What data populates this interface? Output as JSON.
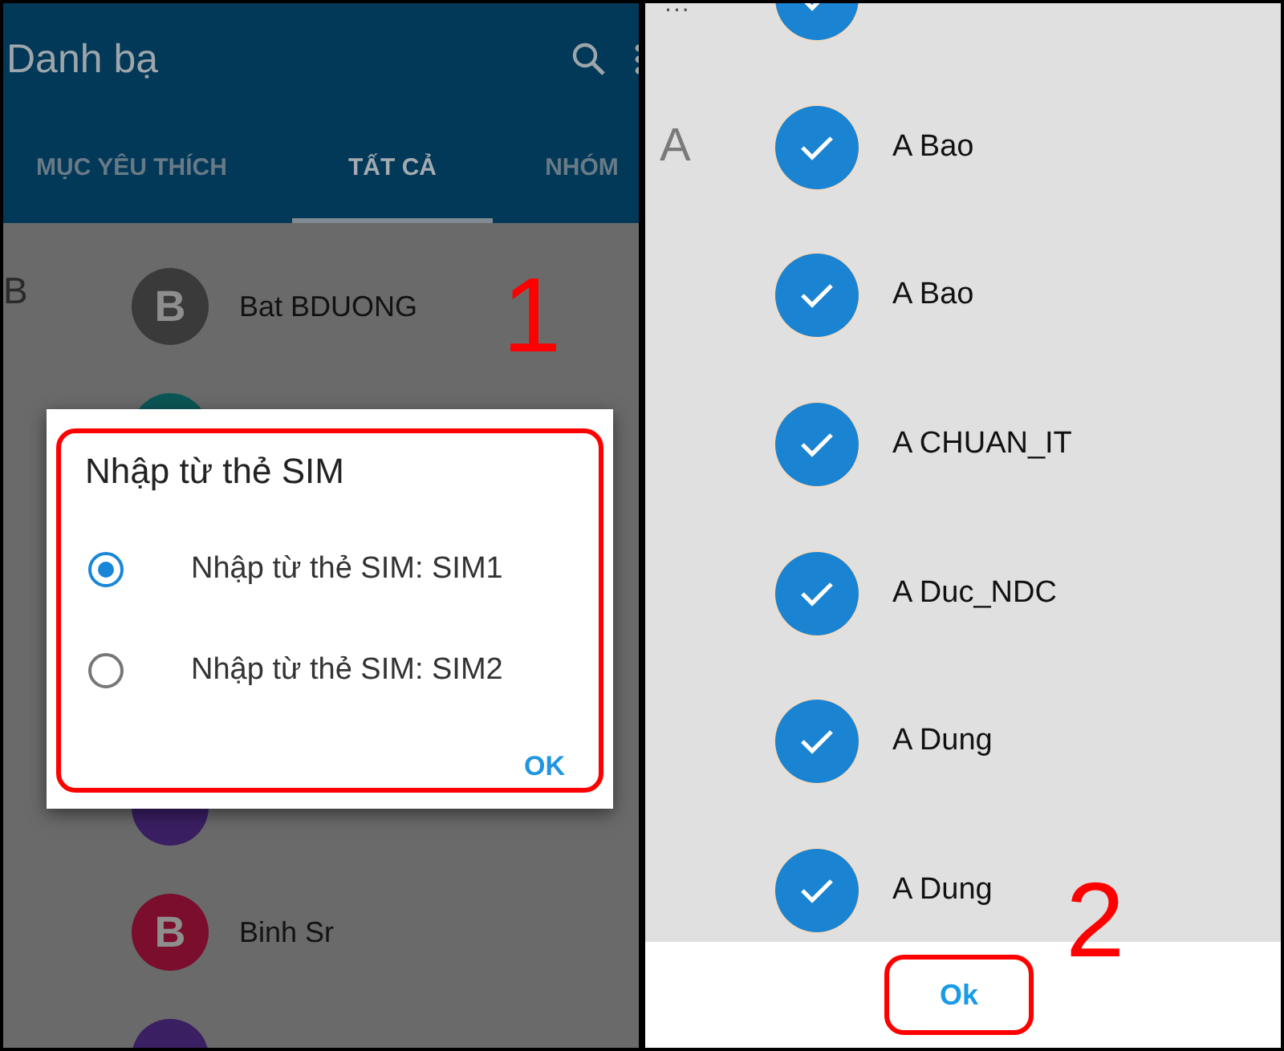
{
  "left_screen": {
    "app_bar": {
      "title": "Danh bạ"
    },
    "tabs": [
      {
        "label": "MỤC YÊU THÍCH",
        "selected": false
      },
      {
        "label": "TẤT CẢ",
        "selected": true
      },
      {
        "label": "NHÓM",
        "selected": false
      }
    ],
    "contacts": [
      {
        "section": "B",
        "initial": "B",
        "name": "Bat BDUONG",
        "color": "#3a3a3a"
      },
      {
        "color": "#0c5656"
      },
      {
        "color": "#3a1f63"
      },
      {
        "initial": "B",
        "name": "Binh Sr",
        "color": "#7a0e2c"
      },
      {
        "color": "#3a1f63"
      }
    ],
    "dialog": {
      "title": "Nhập từ thẻ SIM",
      "options": [
        {
          "label": "Nhập từ thẻ SIM: SIM1",
          "selected": true
        },
        {
          "label": "Nhập từ thẻ SIM: SIM2",
          "selected": false
        }
      ],
      "button": "OK"
    }
  },
  "right_screen": {
    "index_mark": "...",
    "contacts": [
      {
        "checked": true
      },
      {
        "section": "A",
        "name": "A Bao",
        "checked": true
      },
      {
        "name": "A Bao",
        "checked": true
      },
      {
        "name": "A CHUAN_IT",
        "checked": true
      },
      {
        "name": "A Duc_NDC",
        "checked": true
      },
      {
        "name": "A Dung",
        "checked": true
      },
      {
        "name": "A Dung",
        "checked": true
      }
    ],
    "button": "Ok"
  },
  "annotations": [
    "1",
    "2"
  ]
}
